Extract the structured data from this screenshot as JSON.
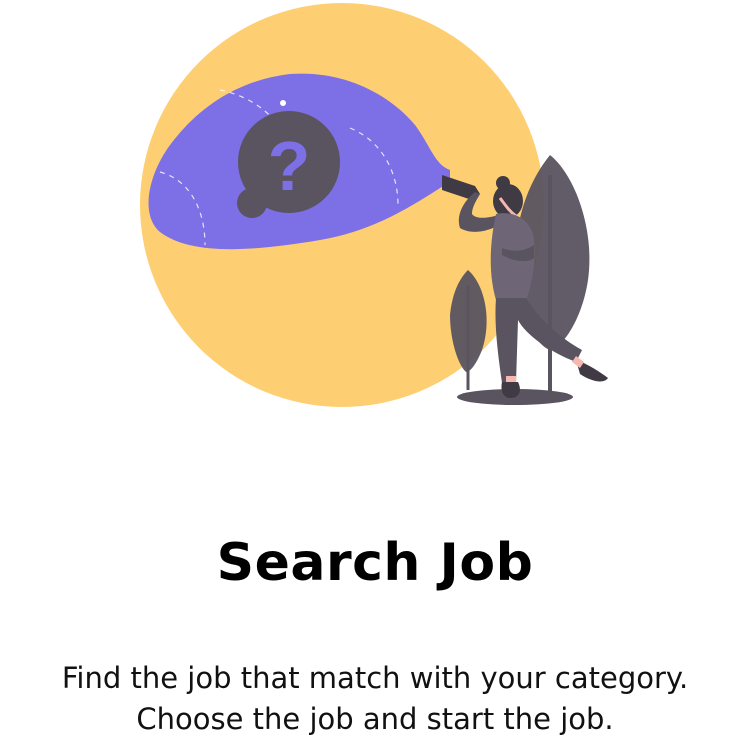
{
  "onboarding": {
    "title": "Search Job",
    "description_lines": [
      "Find the job that match with your category.",
      "Choose the job and start the job."
    ],
    "illustration": "woman-with-flashlight-question-illustration"
  },
  "colors": {
    "circle": "#FECF72",
    "beam": "#7D6FE6",
    "dark": "#5A5360",
    "text": "#000000",
    "background": "#FFFFFF"
  }
}
